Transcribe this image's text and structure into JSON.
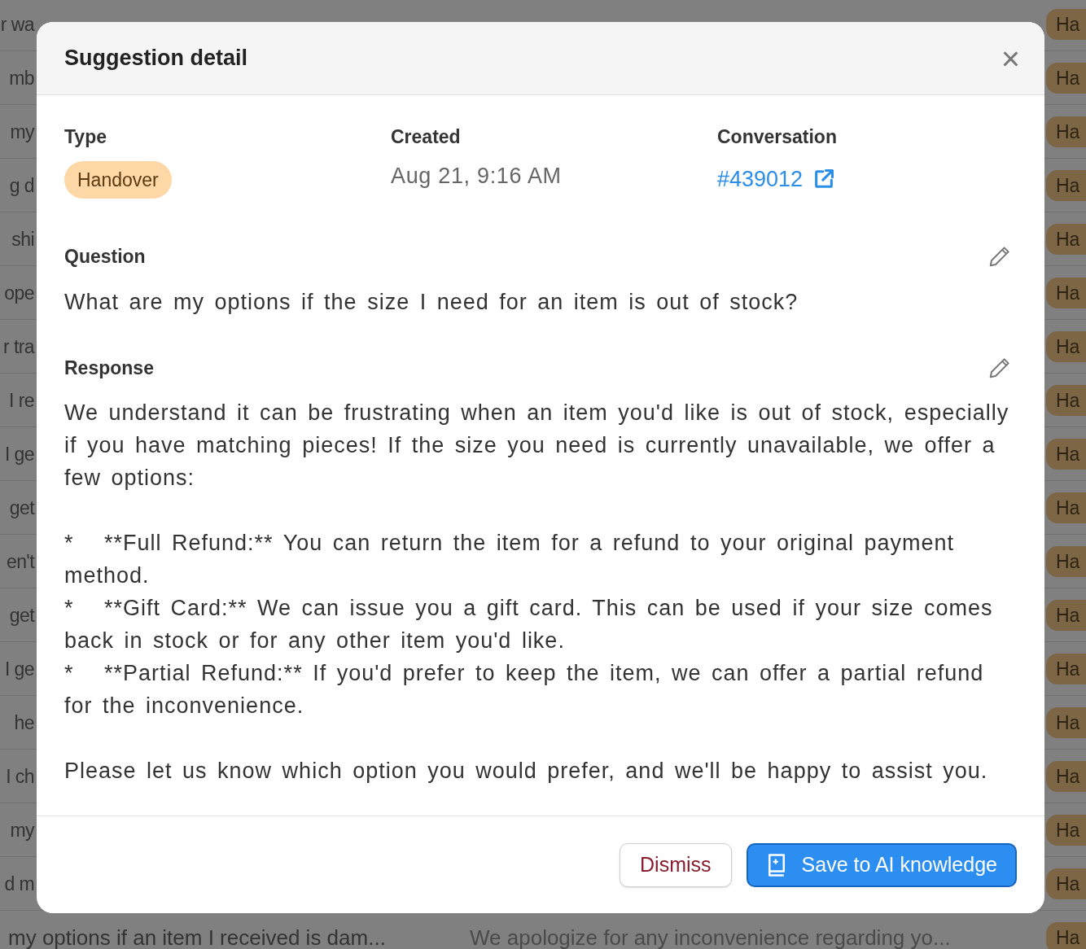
{
  "background_table": {
    "rows": [
      {
        "column_1": "r wa",
        "type": "Ha"
      },
      {
        "column_1": "mb",
        "type": "Ha"
      },
      {
        "column_1": "my",
        "type": "Ha"
      },
      {
        "column_1": "g d",
        "type": "Ha"
      },
      {
        "column_1": "shi",
        "type": "Ha"
      },
      {
        "column_1": "ope",
        "type": "Ha"
      },
      {
        "column_1": "r tra",
        "type": "Ha"
      },
      {
        "column_1": "I re",
        "type": "Ha"
      },
      {
        "column_1": "I ge",
        "type": "Ha"
      },
      {
        "column_1": "get",
        "type": "Ha"
      },
      {
        "column_1": "en't",
        "type": "Ha"
      },
      {
        "column_1": "get",
        "type": "Ha"
      },
      {
        "column_1": "I ge",
        "type": "Ha"
      },
      {
        "column_1": "he",
        "type": "Ha"
      },
      {
        "column_1": "I ch",
        "type": "Ha"
      },
      {
        "column_1": "my",
        "type": "Ha"
      },
      {
        "column_1": "d m",
        "type": "Ha"
      },
      {
        "column_1": "my options if an item I received is dam...",
        "column_2": "We apologize for any inconvenience regarding yo...",
        "type": "Ha"
      }
    ]
  },
  "dialog": {
    "title": "Suggestion detail",
    "close": "×",
    "fields": [
      {
        "kind": "badge",
        "label": "Type",
        "value": "Handover"
      },
      {
        "kind": "text",
        "label": "Created",
        "value": "Aug 21, 9:16 AM"
      },
      {
        "kind": "link",
        "label": "Conversation",
        "value": "#439012"
      }
    ],
    "question": {
      "label": "Question",
      "text": "What are my options if the size I need for an item is out of stock?"
    },
    "response": {
      "label": "Response",
      "text": "We understand it can be frustrating when an item you'd like is out of stock, especially if you have matching pieces! If the size you need is currently unavailable, we offer a few options:\n\n*   **Full Refund:** You can return the item for a refund to your original payment method.\n*   **Gift Card:** We can issue you a gift card. This can be used if your size comes back in stock or for any other item you'd like.\n*   **Partial Refund:** If you'd prefer to keep the item, we can offer a partial refund for the inconvenience.\n\nPlease let us know which option you would prefer, and we'll be happy to assist you."
    },
    "buttons": [
      {
        "kind": "secondary",
        "label": "Dismiss"
      },
      {
        "kind": "primary",
        "label": "Save to AI knowledge"
      }
    ]
  }
}
